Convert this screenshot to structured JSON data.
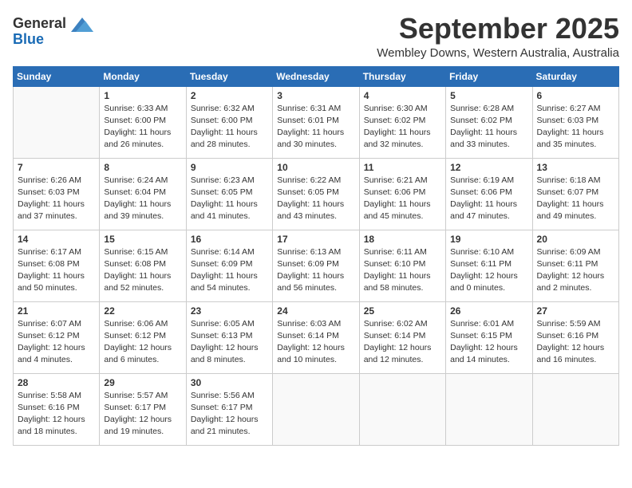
{
  "header": {
    "logo_general": "General",
    "logo_blue": "Blue",
    "month": "September 2025",
    "location": "Wembley Downs, Western Australia, Australia"
  },
  "columns": [
    "Sunday",
    "Monday",
    "Tuesday",
    "Wednesday",
    "Thursday",
    "Friday",
    "Saturday"
  ],
  "weeks": [
    [
      {
        "day": "",
        "info": ""
      },
      {
        "day": "1",
        "info": "Sunrise: 6:33 AM\nSunset: 6:00 PM\nDaylight: 11 hours and 26 minutes."
      },
      {
        "day": "2",
        "info": "Sunrise: 6:32 AM\nSunset: 6:00 PM\nDaylight: 11 hours and 28 minutes."
      },
      {
        "day": "3",
        "info": "Sunrise: 6:31 AM\nSunset: 6:01 PM\nDaylight: 11 hours and 30 minutes."
      },
      {
        "day": "4",
        "info": "Sunrise: 6:30 AM\nSunset: 6:02 PM\nDaylight: 11 hours and 32 minutes."
      },
      {
        "day": "5",
        "info": "Sunrise: 6:28 AM\nSunset: 6:02 PM\nDaylight: 11 hours and 33 minutes."
      },
      {
        "day": "6",
        "info": "Sunrise: 6:27 AM\nSunset: 6:03 PM\nDaylight: 11 hours and 35 minutes."
      }
    ],
    [
      {
        "day": "7",
        "info": "Sunrise: 6:26 AM\nSunset: 6:03 PM\nDaylight: 11 hours and 37 minutes."
      },
      {
        "day": "8",
        "info": "Sunrise: 6:24 AM\nSunset: 6:04 PM\nDaylight: 11 hours and 39 minutes."
      },
      {
        "day": "9",
        "info": "Sunrise: 6:23 AM\nSunset: 6:05 PM\nDaylight: 11 hours and 41 minutes."
      },
      {
        "day": "10",
        "info": "Sunrise: 6:22 AM\nSunset: 6:05 PM\nDaylight: 11 hours and 43 minutes."
      },
      {
        "day": "11",
        "info": "Sunrise: 6:21 AM\nSunset: 6:06 PM\nDaylight: 11 hours and 45 minutes."
      },
      {
        "day": "12",
        "info": "Sunrise: 6:19 AM\nSunset: 6:06 PM\nDaylight: 11 hours and 47 minutes."
      },
      {
        "day": "13",
        "info": "Sunrise: 6:18 AM\nSunset: 6:07 PM\nDaylight: 11 hours and 49 minutes."
      }
    ],
    [
      {
        "day": "14",
        "info": "Sunrise: 6:17 AM\nSunset: 6:08 PM\nDaylight: 11 hours and 50 minutes."
      },
      {
        "day": "15",
        "info": "Sunrise: 6:15 AM\nSunset: 6:08 PM\nDaylight: 11 hours and 52 minutes."
      },
      {
        "day": "16",
        "info": "Sunrise: 6:14 AM\nSunset: 6:09 PM\nDaylight: 11 hours and 54 minutes."
      },
      {
        "day": "17",
        "info": "Sunrise: 6:13 AM\nSunset: 6:09 PM\nDaylight: 11 hours and 56 minutes."
      },
      {
        "day": "18",
        "info": "Sunrise: 6:11 AM\nSunset: 6:10 PM\nDaylight: 11 hours and 58 minutes."
      },
      {
        "day": "19",
        "info": "Sunrise: 6:10 AM\nSunset: 6:11 PM\nDaylight: 12 hours and 0 minutes."
      },
      {
        "day": "20",
        "info": "Sunrise: 6:09 AM\nSunset: 6:11 PM\nDaylight: 12 hours and 2 minutes."
      }
    ],
    [
      {
        "day": "21",
        "info": "Sunrise: 6:07 AM\nSunset: 6:12 PM\nDaylight: 12 hours and 4 minutes."
      },
      {
        "day": "22",
        "info": "Sunrise: 6:06 AM\nSunset: 6:12 PM\nDaylight: 12 hours and 6 minutes."
      },
      {
        "day": "23",
        "info": "Sunrise: 6:05 AM\nSunset: 6:13 PM\nDaylight: 12 hours and 8 minutes."
      },
      {
        "day": "24",
        "info": "Sunrise: 6:03 AM\nSunset: 6:14 PM\nDaylight: 12 hours and 10 minutes."
      },
      {
        "day": "25",
        "info": "Sunrise: 6:02 AM\nSunset: 6:14 PM\nDaylight: 12 hours and 12 minutes."
      },
      {
        "day": "26",
        "info": "Sunrise: 6:01 AM\nSunset: 6:15 PM\nDaylight: 12 hours and 14 minutes."
      },
      {
        "day": "27",
        "info": "Sunrise: 5:59 AM\nSunset: 6:16 PM\nDaylight: 12 hours and 16 minutes."
      }
    ],
    [
      {
        "day": "28",
        "info": "Sunrise: 5:58 AM\nSunset: 6:16 PM\nDaylight: 12 hours and 18 minutes."
      },
      {
        "day": "29",
        "info": "Sunrise: 5:57 AM\nSunset: 6:17 PM\nDaylight: 12 hours and 19 minutes."
      },
      {
        "day": "30",
        "info": "Sunrise: 5:56 AM\nSunset: 6:17 PM\nDaylight: 12 hours and 21 minutes."
      },
      {
        "day": "",
        "info": ""
      },
      {
        "day": "",
        "info": ""
      },
      {
        "day": "",
        "info": ""
      },
      {
        "day": "",
        "info": ""
      }
    ]
  ]
}
